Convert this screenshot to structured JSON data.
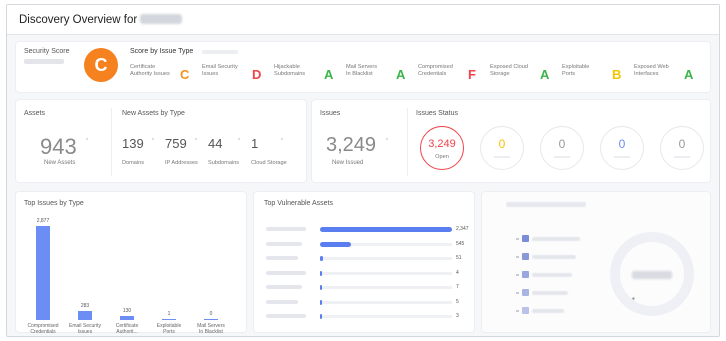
{
  "page": {
    "title": "Discovery Overview for",
    "org_name_redacted": true
  },
  "security": {
    "label": "Security Score",
    "overall_grade": "C",
    "score_by_type_label": "Score by Issue Type",
    "categories": [
      {
        "name": "Certificate\nAuthority Issues",
        "grade": "C",
        "color": "#f5911e"
      },
      {
        "name": "Email Security\nIssues",
        "grade": "D",
        "color": "#f0434a"
      },
      {
        "name": "Hijackable\nSubdomains",
        "grade": "A",
        "color": "#39b54a"
      },
      {
        "name": "Mail Servers\nIn Blacklist",
        "grade": "A",
        "color": "#39b54a"
      },
      {
        "name": "Compromised\nCredentials",
        "grade": "F",
        "color": "#f0434a"
      },
      {
        "name": "Exposed Cloud\nStorage",
        "grade": "A",
        "color": "#39b54a"
      },
      {
        "name": "Exploitable\nPorts",
        "grade": "B",
        "color": "#f5c400"
      },
      {
        "name": "Exposed Web\nInterfaces",
        "grade": "A",
        "color": "#39b54a"
      }
    ]
  },
  "assets": {
    "label": "Assets",
    "value": "943",
    "sub": "New Assets",
    "by_type_label": "New Assets by Type",
    "types": [
      {
        "value": "139",
        "label": "Domains"
      },
      {
        "value": "759",
        "label": "IP Addresses"
      },
      {
        "value": "44",
        "label": "Subdomains"
      },
      {
        "value": "1",
        "label": "Cloud Storage"
      }
    ]
  },
  "issues": {
    "label": "Issues",
    "value": "3,249",
    "sub": "New Issued",
    "status_label": "Issues Status",
    "statuses": [
      {
        "value": "3,249",
        "label": "Open",
        "color": "#f0434a",
        "highlight": true
      },
      {
        "value": "0",
        "label": "",
        "color": "#f5c400",
        "highlight": false
      },
      {
        "value": "0",
        "label": "",
        "color": "#9a9a9a",
        "highlight": false
      },
      {
        "value": "0",
        "label": "",
        "color": "#6c8df3",
        "highlight": false
      },
      {
        "value": "0",
        "label": "",
        "color": "#9a9a9a",
        "highlight": false
      }
    ]
  },
  "top_issues": {
    "label": "Top Issues by Type",
    "chart_data": {
      "type": "bar",
      "categories": [
        "Compromised\nCredentials",
        "Email Security\nIssues",
        "Certificate\nAuthorit...",
        "Exploitable\nPorts",
        "Mail Servers\nIn Blacklist"
      ],
      "values": [
        2877,
        283,
        130,
        1,
        0
      ],
      "value_labels": [
        "2,877",
        "283",
        "130",
        "1",
        "0"
      ],
      "ylim": [
        0,
        2877
      ],
      "color": "#6c8df3"
    }
  },
  "top_assets": {
    "label": "Top Vulnerable Assets",
    "chart_data": {
      "type": "bar",
      "orientation": "horizontal",
      "values": [
        2347,
        545,
        51,
        4,
        7,
        5,
        3
      ],
      "value_labels": [
        "2,347",
        "545",
        "51",
        "4",
        "7",
        "5",
        "3"
      ],
      "xlim": [
        0,
        2347
      ],
      "color": "#5a7ef0"
    }
  },
  "right_panel": {
    "center_label_redacted": true,
    "legend_colors": [
      "#7b8dd6",
      "#8a98d8",
      "#9aa6de",
      "#aab4e3",
      "#bac2ea"
    ]
  }
}
